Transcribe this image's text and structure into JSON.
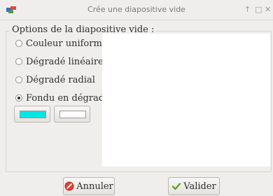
{
  "window": {
    "title": "Crée une diapositive vide",
    "buttons": [
      "↑",
      "□",
      "✕"
    ]
  },
  "options": {
    "legend": "Options de la diapositive vide :",
    "radios": [
      {
        "label": "Couleur uniforme",
        "checked": false
      },
      {
        "label": "Dégradé linéaire",
        "checked": false
      },
      {
        "label": "Dégradé radial",
        "checked": false
      },
      {
        "label": "Fondu en dégradé",
        "checked": true
      }
    ],
    "color1": "#00e5e5",
    "color2": "#ffffff"
  },
  "footer": {
    "cancel_label": "Annuler",
    "ok_label": "Valider"
  }
}
